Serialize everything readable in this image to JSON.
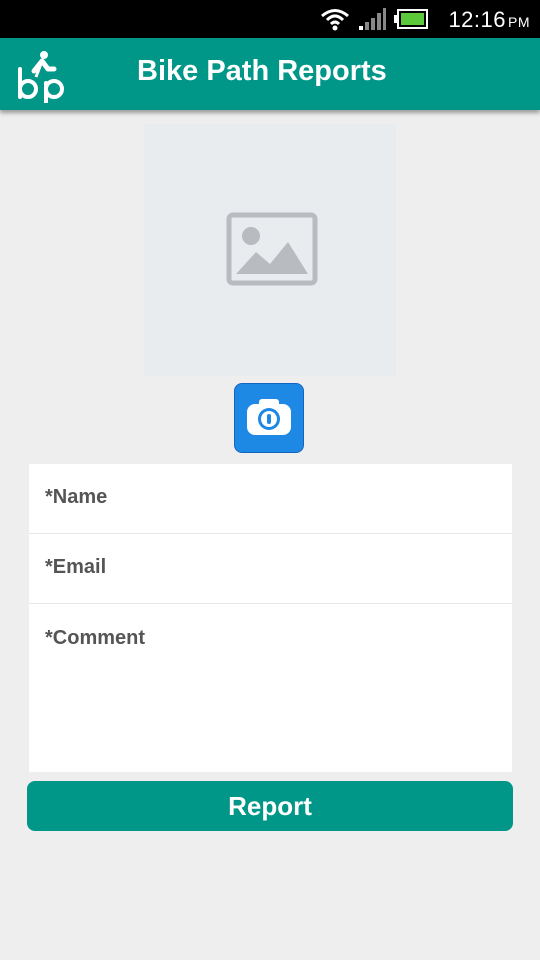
{
  "status_bar": {
    "time": "12:16",
    "ampm": "PM"
  },
  "app_bar": {
    "title": "Bike Path Reports",
    "logo_text": "bp"
  },
  "photo": {
    "placeholder_icon": "image-icon",
    "camera_icon": "camera-icon"
  },
  "form": {
    "name_placeholder": "*Name",
    "email_placeholder": "*Email",
    "comment_placeholder": "*Comment"
  },
  "actions": {
    "report_label": "Report"
  },
  "colors": {
    "primary": "#009688",
    "camera_button": "#1e88e5",
    "background": "#eeeeee"
  }
}
